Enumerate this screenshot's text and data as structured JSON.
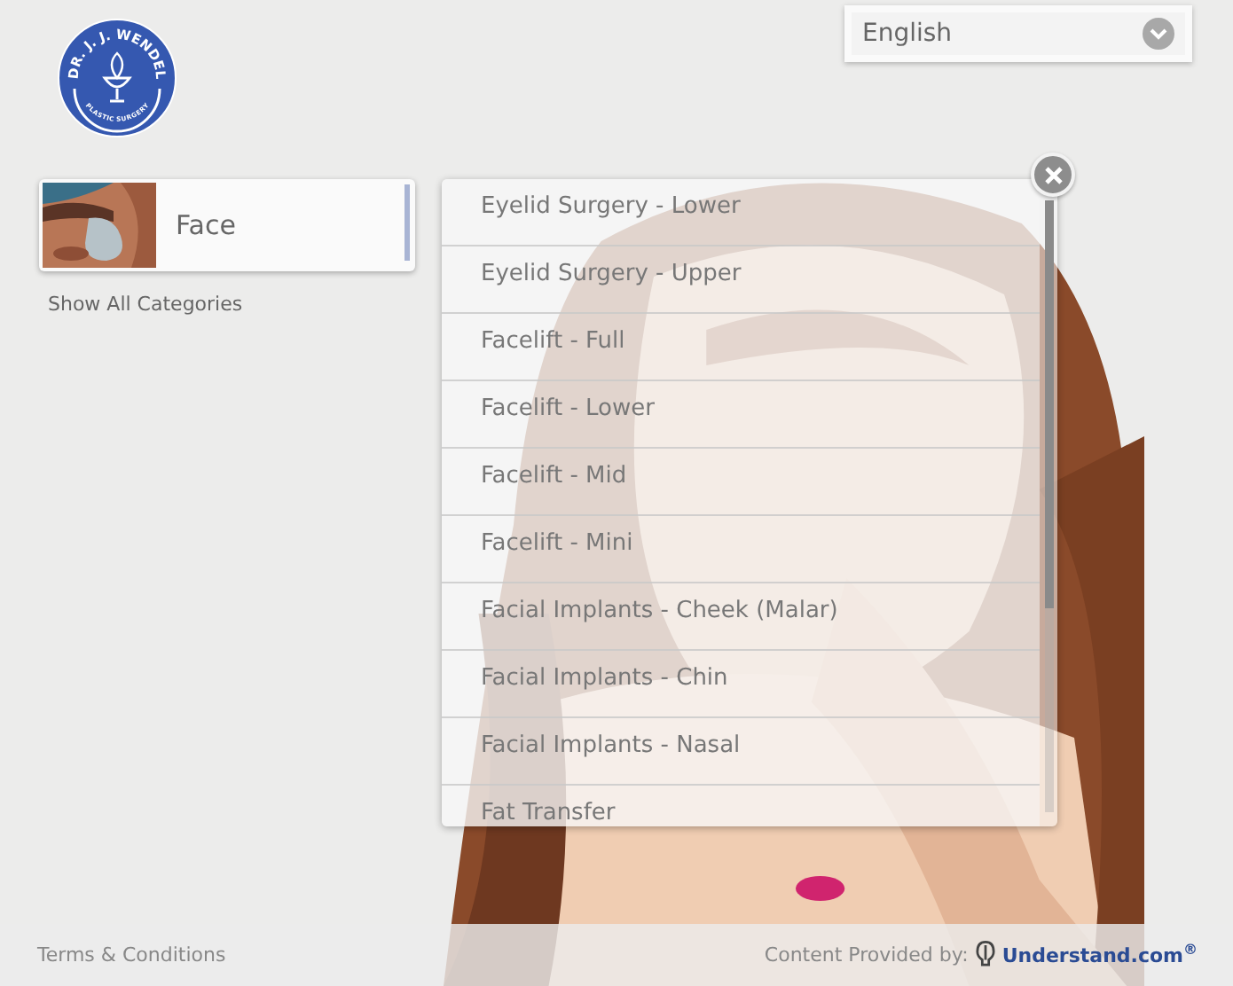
{
  "logo": {
    "top_text": "DR. J. J. WENDEL",
    "bottom_text": "PLASTIC SURGERY"
  },
  "language_select": {
    "value": "English"
  },
  "category": {
    "label": "Face"
  },
  "show_all": "Show All Categories",
  "procedures": [
    {
      "label": "Eyelid Surgery - Lower"
    },
    {
      "label": "Eyelid Surgery - Upper"
    },
    {
      "label": "Facelift - Full"
    },
    {
      "label": "Facelift - Lower"
    },
    {
      "label": "Facelift - Mid"
    },
    {
      "label": "Facelift - Mini"
    },
    {
      "label": "Facial Implants - Cheek (Malar)"
    },
    {
      "label": "Facial Implants - Chin"
    },
    {
      "label": "Facial Implants - Nasal"
    },
    {
      "label": "Fat Transfer"
    }
  ],
  "footer": {
    "terms": "Terms & Conditions",
    "provided_by": "Content Provided by:",
    "brand": "Understand.com",
    "brand_mark": "®"
  }
}
